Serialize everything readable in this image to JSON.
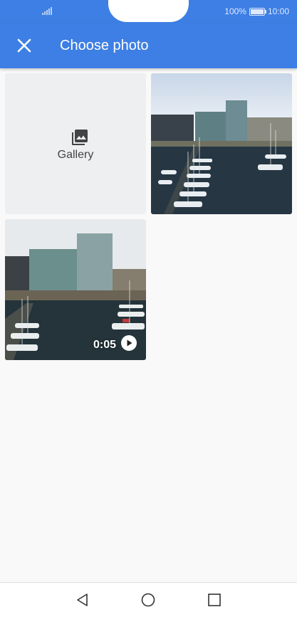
{
  "status_bar": {
    "battery_percent": "100%",
    "battery_level": 1.0,
    "time": "10:00",
    "signal_icon": "signal-bars-icon",
    "battery_icon": "battery-icon"
  },
  "app_bar": {
    "title": "Choose photo",
    "close_icon": "close-icon",
    "color": "#3d7fe4"
  },
  "grid": {
    "gallery_label": "Gallery",
    "gallery_icon": "photo-library-icon",
    "items": [
      {
        "kind": "photo"
      },
      {
        "kind": "video",
        "duration": "0:05",
        "icon": "play-icon"
      }
    ]
  },
  "nav_bar": {
    "back_icon": "back-triangle-icon",
    "home_icon": "home-circle-icon",
    "recents_icon": "recents-square-icon"
  }
}
